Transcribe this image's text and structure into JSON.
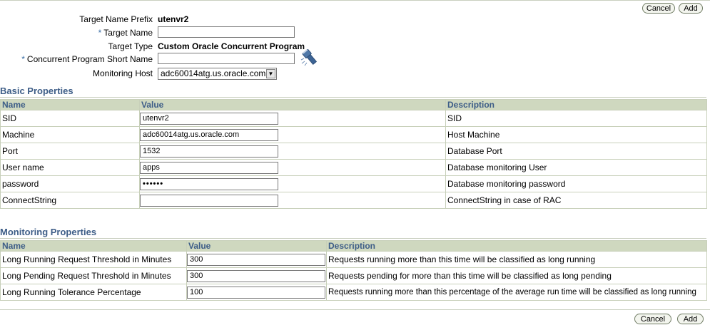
{
  "buttons": {
    "cancel": "Cancel",
    "add": "Add"
  },
  "form": {
    "target_name_prefix_label": "Target Name Prefix",
    "target_name_prefix_value": "utenvr2",
    "target_name_label": "Target Name",
    "target_name_value": "",
    "target_type_label": "Target Type",
    "target_type_value": "Custom Oracle Concurrent Program",
    "program_short_name_label": "Concurrent Program Short Name",
    "program_short_name_value": "",
    "monitoring_host_label": "Monitoring Host",
    "monitoring_host_value": "adc60014atg.us.oracle.com",
    "required_marker": "*"
  },
  "basic": {
    "title": "Basic Properties",
    "headers": {
      "name": "Name",
      "value": "Value",
      "description": "Description"
    },
    "rows": [
      {
        "name": "SID",
        "value": "utenvr2",
        "description": "SID"
      },
      {
        "name": "Machine",
        "value": "adc60014atg.us.oracle.com",
        "description": "Host Machine"
      },
      {
        "name": "Port",
        "value": "1532",
        "description": "Database Port"
      },
      {
        "name": "User name",
        "value": "apps",
        "description": "Database monitoring User"
      },
      {
        "name": "password",
        "value": "••••••",
        "description": "Database monitoring password"
      },
      {
        "name": "ConnectString",
        "value": "",
        "description": "ConnectString in case of RAC"
      }
    ]
  },
  "monitoring": {
    "title": "Monitoring Properties",
    "headers": {
      "name": "Name",
      "value": "Value",
      "description": "Description"
    },
    "rows": [
      {
        "name": "Long Running Request Threshold in Minutes",
        "value": "300",
        "description": "Requests running more than this time will be classified as long running"
      },
      {
        "name": "Long Pending Request Threshold in Minutes",
        "value": "300",
        "description": "Requests pending for more than this time will be classified as long pending"
      },
      {
        "name": "Long Running Tolerance Percentage",
        "value": "100",
        "description": "Requests running more than this percentage of the average run time will be classified as long running"
      }
    ]
  },
  "icons": {
    "flashlight": "flashlight-icon",
    "dropdown": "chevron-down-icon"
  }
}
